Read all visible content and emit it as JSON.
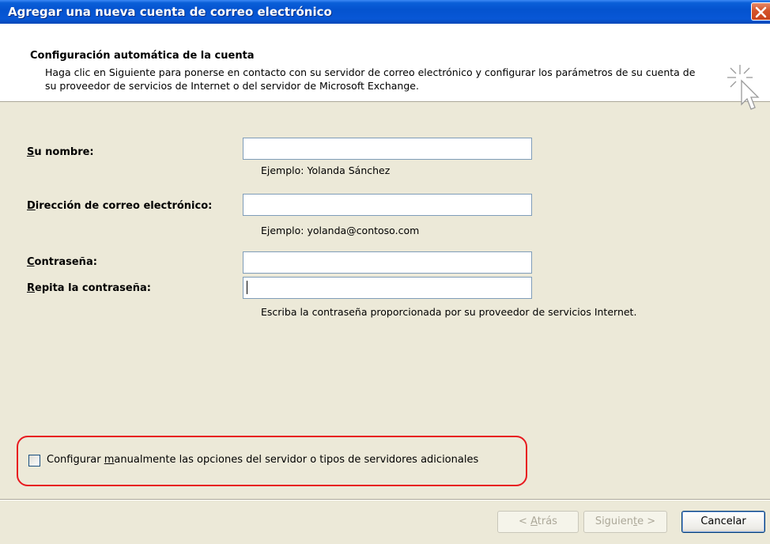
{
  "window": {
    "title": "Agregar una nueva cuenta de correo electrónico"
  },
  "header": {
    "title": "Configuración automática de la cuenta",
    "description": "Haga clic en Siguiente para ponerse en contacto con su servidor de correo electrónico y configurar los parámetros de su cuenta de su proveedor de servicios de Internet o del servidor de Microsoft Exchange."
  },
  "form": {
    "name": {
      "label_accel": "S",
      "label_rest": "u nombre:",
      "value": "",
      "hint": "Ejemplo: Yolanda Sánchez"
    },
    "email": {
      "label_accel": "D",
      "label_rest": "irección de correo electrónico:",
      "value": "",
      "hint": "Ejemplo: yolanda@contoso.com"
    },
    "password": {
      "label_accel": "C",
      "label_rest": "ontraseña:",
      "value": ""
    },
    "password_repeat": {
      "label_accel": "R",
      "label_rest": "epita la contraseña:",
      "value": "",
      "hint": "Escriba la contraseña proporcionada por su proveedor de servicios Internet."
    }
  },
  "manual_config": {
    "label_before": "Configurar ",
    "label_accel": "m",
    "label_after": "anualmente las opciones del servidor o tipos de servidores adicionales",
    "checked": false
  },
  "buttons": {
    "back": {
      "label_before": "< ",
      "label_accel": "A",
      "label_after": "trás",
      "enabled": false
    },
    "next": {
      "label_before": "Siguien",
      "label_accel": "t",
      "label_after": "e >",
      "enabled": false
    },
    "cancel": {
      "label": "Cancelar",
      "enabled": true
    }
  },
  "colors": {
    "titlebar": "#0453cf",
    "dialog_bg": "#ece9d8",
    "highlight_border": "#e8191f"
  },
  "icons": {
    "close": "close-icon",
    "wizard": "cursor-sparkle-icon"
  }
}
